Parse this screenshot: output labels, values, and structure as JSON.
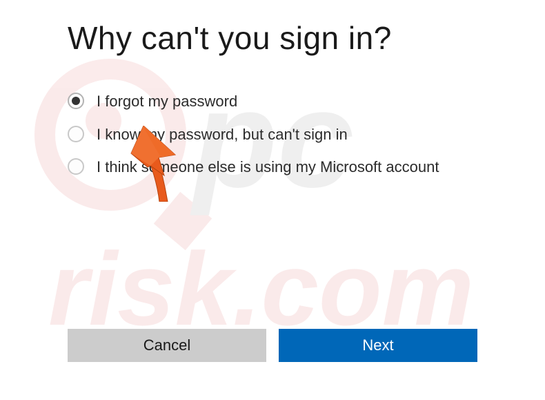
{
  "heading": "Why can't you sign in?",
  "options": [
    {
      "label": "I forgot my password",
      "selected": true
    },
    {
      "label": "I know my password, but can't sign in",
      "selected": false
    },
    {
      "label": "I think someone else is using my Microsoft account",
      "selected": false
    }
  ],
  "buttons": {
    "cancel": "Cancel",
    "next": "Next"
  },
  "watermark_text_top": "pc",
  "watermark_text_bottom": "risk.com",
  "colors": {
    "primary": "#0067b8",
    "secondary": "#cccccc",
    "pointer": "#e85a1c"
  }
}
